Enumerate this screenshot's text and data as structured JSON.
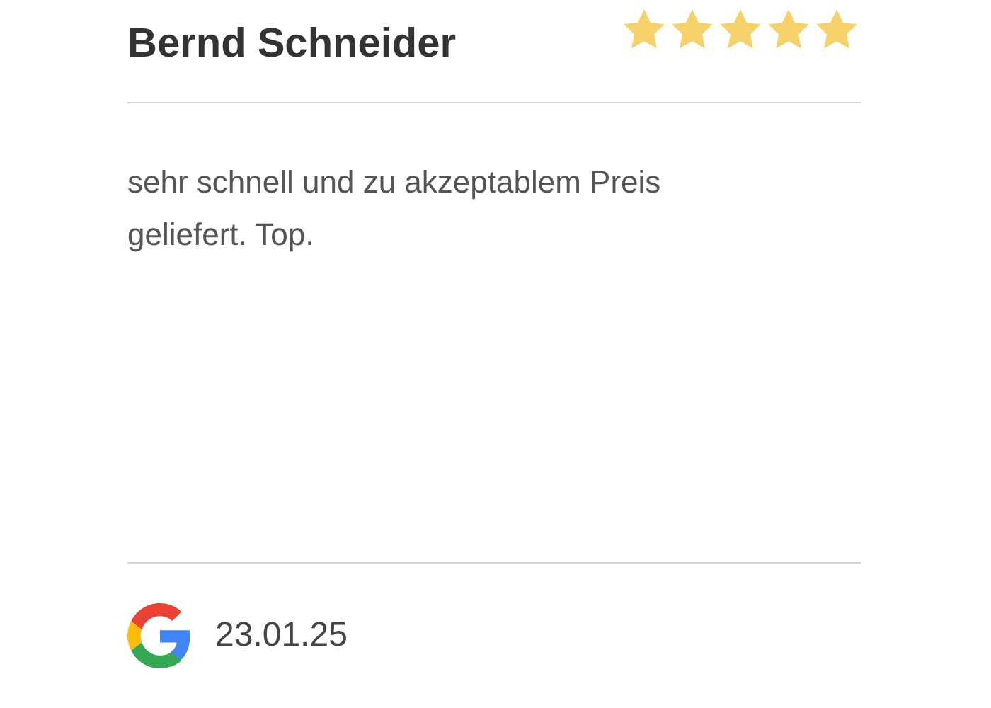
{
  "review": {
    "author": "Bernd Schneider",
    "stars": 5,
    "text": "sehr schnell und zu akzeptablem Preis geliefert. Top.",
    "date": "23.01.25"
  }
}
